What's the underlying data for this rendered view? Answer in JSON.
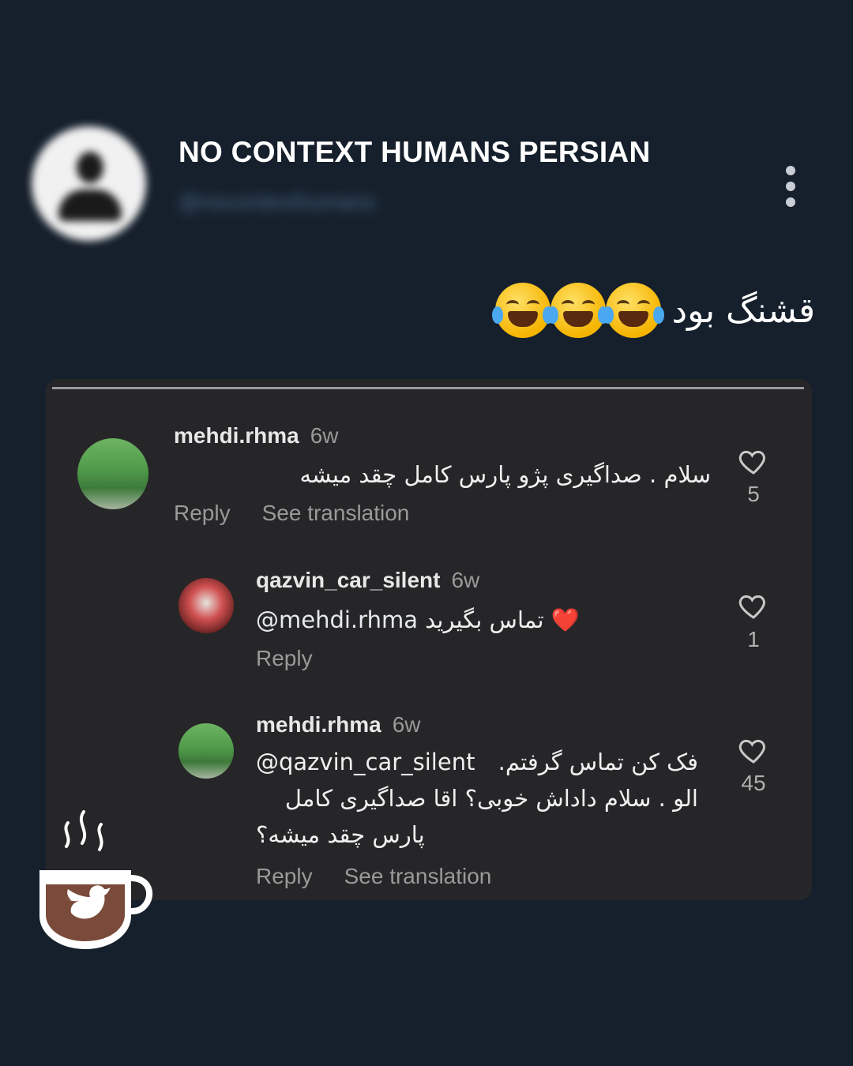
{
  "profile": {
    "name": "NO CONTEXT HUMANS PERSIAN",
    "handle": "@nocontexthumans"
  },
  "tweet": {
    "text": "قشنگ بود",
    "emoji": "😂😂😂"
  },
  "comments": [
    {
      "username": "mehdi.rhma",
      "time": "6w",
      "text": "سلام . صداگیری پژو پارس کامل چقد میشه",
      "reply_label": "Reply",
      "translate_label": "See translation",
      "likes": "5"
    },
    {
      "username": "qazvin_car_silent",
      "time": "6w",
      "mention": "@mehdi.rhma",
      "text": "تماس بگیرید",
      "emoji": "❤️",
      "reply_label": "Reply",
      "likes": "1"
    },
    {
      "username": "mehdi.rhma",
      "time": "6w",
      "mention": "@qazvin_car_silent",
      "text_line1": "فک کن تماس گرفتم.",
      "text_line2": "الو . سلام داداش خوبی؟ اقا صداگیری کامل",
      "text_line3": "پارس چقد میشه؟",
      "reply_label": "Reply",
      "translate_label": "See translation",
      "likes": "45"
    }
  ],
  "colors": {
    "background": "#16202c",
    "panel": "#262628",
    "logo_cup": "#7a4a3a"
  }
}
